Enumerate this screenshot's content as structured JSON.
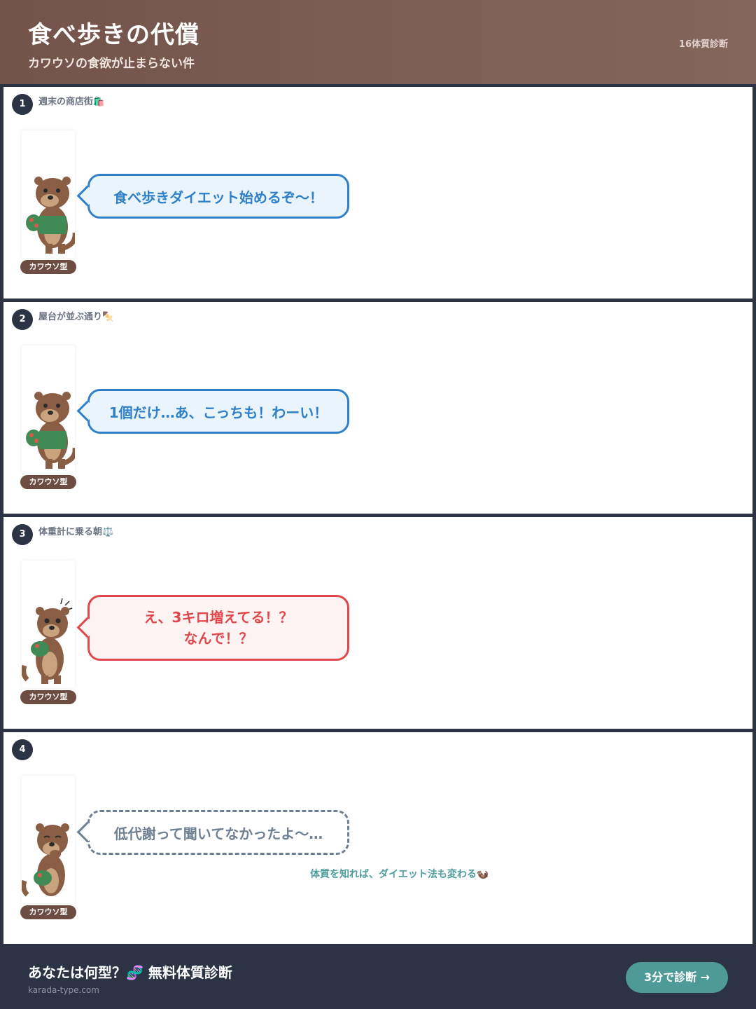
{
  "header": {
    "title": "食べ歩きの代償",
    "subtitle": "カワウソの食欲が止まらない件",
    "brand": "16体質診断"
  },
  "panels": [
    {
      "number": "1",
      "caption": "週末の商店街🛍️",
      "character_tag": "カワウソ型",
      "speech": "食べ歩きダイエット始めるぞ〜！"
    },
    {
      "number": "2",
      "caption": "屋台が並ぶ通り🍢",
      "character_tag": "カワウソ型",
      "speech": "1個だけ…あ、こっちも！わーい！"
    },
    {
      "number": "3",
      "caption": "体重計に乗る朝⚖️",
      "character_tag": "カワウソ型",
      "speech": "え、3キロ増えてる！？\nなんで！？"
    },
    {
      "number": "4",
      "caption": "",
      "character_tag": "カワウソ型",
      "speech": "低代謝って聞いてなかったよ〜…",
      "tagline": "体質を知れば、ダイエット法も変わる🦦"
    }
  ],
  "footer": {
    "cta_text": "あなたは何型？🧬 無料体質診断",
    "site": "karada-type.com",
    "button_label": "3分で診断 →"
  },
  "colors": {
    "header_brown": "#74544a",
    "navy": "#2b3345",
    "speech_blue": "#2f80c8",
    "alarm_red": "#e0474c",
    "teal": "#4e9a98"
  }
}
